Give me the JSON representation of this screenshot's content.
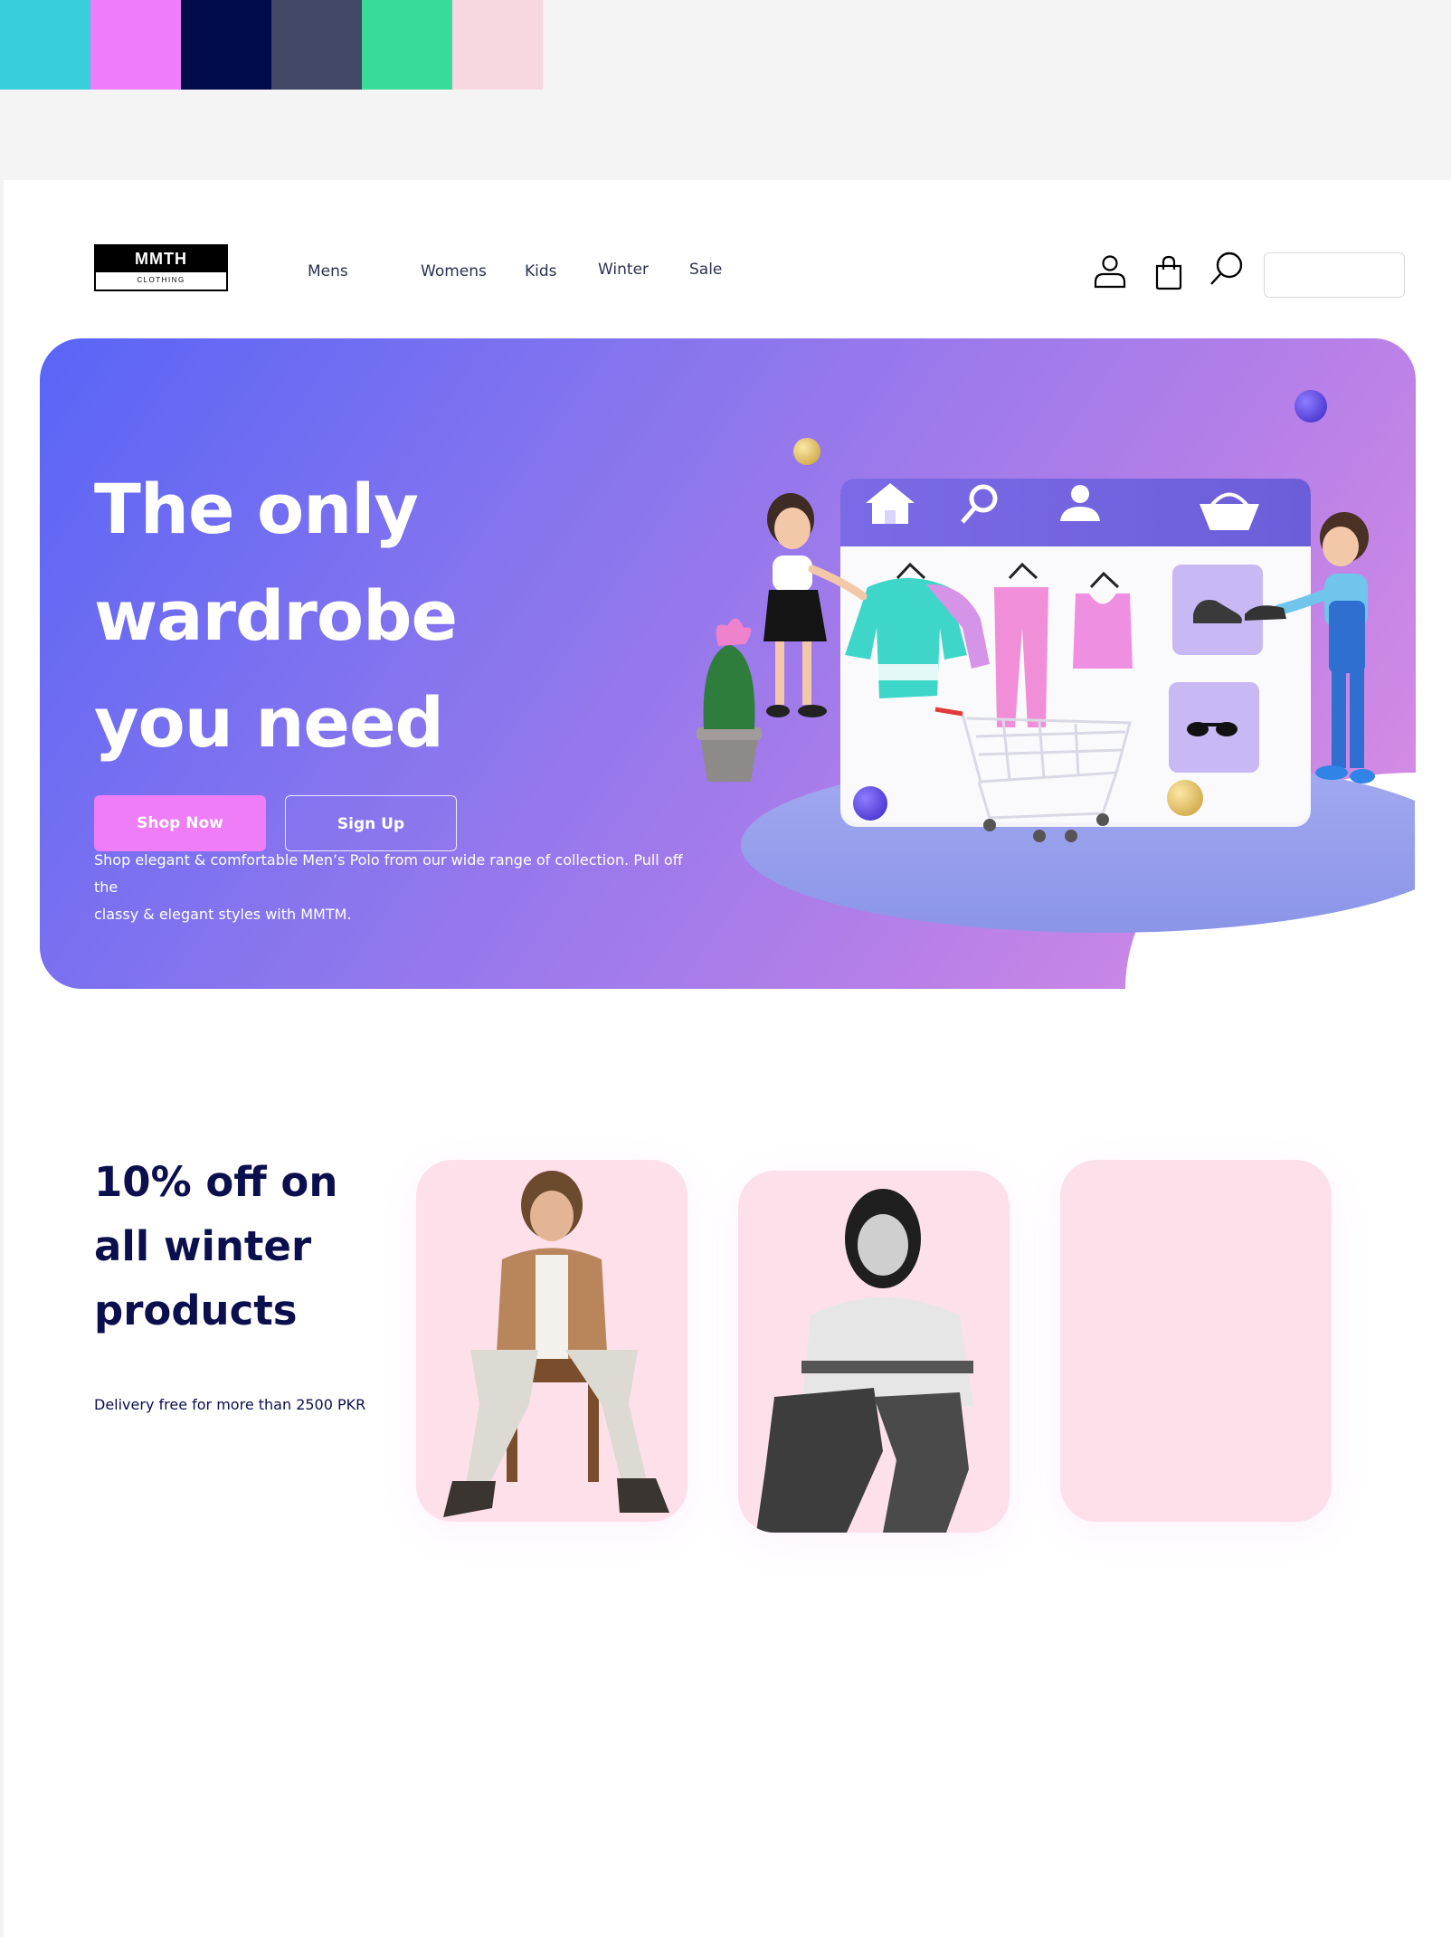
{
  "palette": [
    "#38cedc",
    "#ef7cfb",
    "#000b4b",
    "#444867",
    "#3adb98",
    "#f8d8e0"
  ],
  "logo": {
    "name": "MMTH",
    "tagline": "CLOTHING"
  },
  "nav": {
    "items": [
      "Mens",
      "Womens",
      "Kids",
      "Winter",
      "Sale"
    ]
  },
  "header": {
    "icons": [
      "user-icon",
      "shopping-bag-icon",
      "search-icon"
    ],
    "search_placeholder": ""
  },
  "hero": {
    "title_line1": "The only wardrobe",
    "title_line2": "you need",
    "desc_line1": "Shop elegant & comfortable Men’s Polo from our wide range of collection. Pull off the",
    "desc_line2": "classy & elegant styles with MMTM.",
    "shop_button": "Shop Now",
    "signup_button": "Sign Up",
    "gradient": [
      "#5965f6",
      "#df8fe2"
    ]
  },
  "promo": {
    "title_line1": "10% off on",
    "title_line2": "all winter",
    "title_line3": "products",
    "subtitle": "Delivery free for more than 2500 PKR",
    "card_color": "#fde0ea"
  }
}
